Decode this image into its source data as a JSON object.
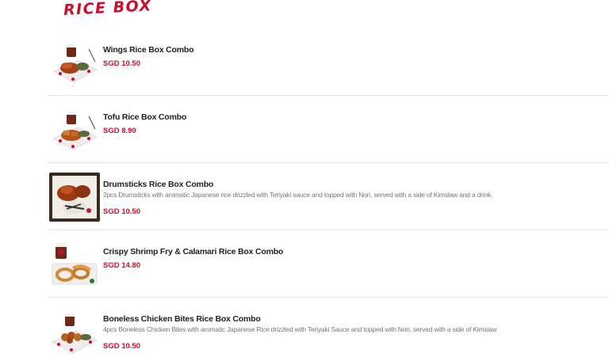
{
  "section": {
    "title": "RICE BOX"
  },
  "items": [
    {
      "name": "Wings Rice Box Combo",
      "description": "",
      "price": "SGD 10.50",
      "photo": "wings-rice-box-photo"
    },
    {
      "name": "Tofu Rice Box Combo",
      "description": "",
      "price": "SGD 8.90",
      "photo": "tofu-rice-box-photo"
    },
    {
      "name": "Drumsticks Rice Box Combo",
      "description": "2pcs Drumsticks with aromatic Japanese rice drizzled with Teriyaki sauce and topped with Nori, served with a side of Kimslaw and a drink.",
      "price": "SGD 10.50",
      "photo": "drumsticks-rice-box-photo"
    },
    {
      "name": "Crispy Shrimp Fry & Calamari Rice Box Combo",
      "description": "",
      "price": "SGD 14.80",
      "photo": "shrimp-calamari-rice-box-photo"
    },
    {
      "name": "Boneless Chicken Bites Rice Box Combo",
      "description": "4pcs Boneless Chicken Bites with aromatic Japanese Rice drizzled with Teriyaki Sauce and topped with Nori, served with a side of Kimslaw",
      "price": "SGD 10.50",
      "photo": "boneless-chicken-rice-box-photo"
    }
  ],
  "colors": {
    "accent": "#c8102e",
    "divider": "#e3e3e3",
    "text": "#222222",
    "muted": "#777777"
  }
}
